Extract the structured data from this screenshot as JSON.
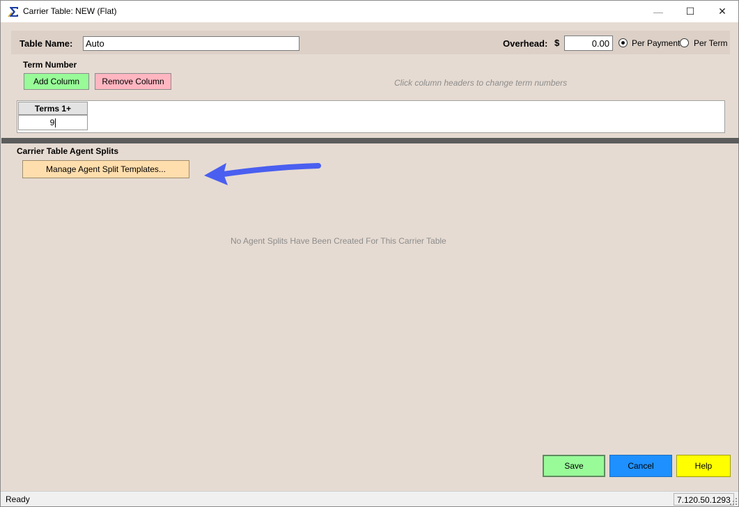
{
  "window": {
    "title": "Carrier Table: NEW (Flat)",
    "app_icon": "sigma-icon",
    "controls": {
      "minimize": "—",
      "maximize": "☐",
      "close": "✕"
    }
  },
  "header": {
    "table_name_label": "Table Name:",
    "table_name_value": "Auto",
    "overhead_label": "Overhead:",
    "currency_symbol": "$",
    "overhead_value": "0.00",
    "radio_per_payment": "Per Payment",
    "radio_per_term": "Per Term",
    "selected_radio": "Per Payment"
  },
  "term_number": {
    "label": "Term Number",
    "add_button": "Add Column",
    "remove_button": "Remove Column",
    "hint": "Click column headers to change term numbers",
    "columns": [
      {
        "header": "Terms 1+",
        "value": "9"
      }
    ]
  },
  "agent_splits": {
    "label": "Carrier Table Agent Splits",
    "manage_button": "Manage Agent Split Templates...",
    "empty_message": "No Agent Splits Have Been Created For This Carrier Table"
  },
  "footer": {
    "save": "Save",
    "cancel": "Cancel",
    "help": "Help"
  },
  "statusbar": {
    "status": "Ready",
    "version": "7.120.50.1293"
  },
  "colors": {
    "background": "#e6dbd2",
    "add_button": "#98fb98",
    "remove_button": "#ffb6c1",
    "manage_button": "#ffdead",
    "save_button": "#98fb98",
    "cancel_button": "#1e90ff",
    "help_button": "#ffff00",
    "annotation_arrow": "#4a5ff0"
  }
}
